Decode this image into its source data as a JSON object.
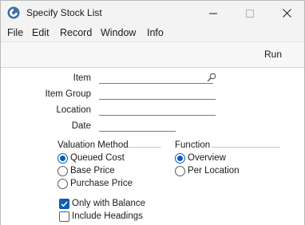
{
  "window": {
    "title": "Specify Stock List"
  },
  "menu": [
    "File",
    "Edit",
    "Record",
    "Window",
    "Info"
  ],
  "toolbar": {
    "run_label": "Run"
  },
  "fields": {
    "item": {
      "label": "Item",
      "value": ""
    },
    "item_group": {
      "label": "Item Group",
      "value": ""
    },
    "location": {
      "label": "Location",
      "value": ""
    },
    "date": {
      "label": "Date",
      "value": ""
    }
  },
  "valuation": {
    "title": "Valuation Method",
    "options": [
      "Queued Cost",
      "Base Price",
      "Purchase Price"
    ],
    "selected": "Queued Cost"
  },
  "function": {
    "title": "Function",
    "options": [
      "Overview",
      "Per Location"
    ],
    "selected": "Overview"
  },
  "checkboxes": {
    "only_with_balance": {
      "label": "Only with Balance",
      "checked": true
    },
    "include_headings": {
      "label": "Include Headings",
      "checked": false
    }
  },
  "colors": {
    "accent": "#0a5fb8",
    "background": "#ffffff",
    "chrome": "#f3f3f3"
  },
  "icons": {
    "app": "app-logo-icon",
    "lookup": "search-icon"
  }
}
